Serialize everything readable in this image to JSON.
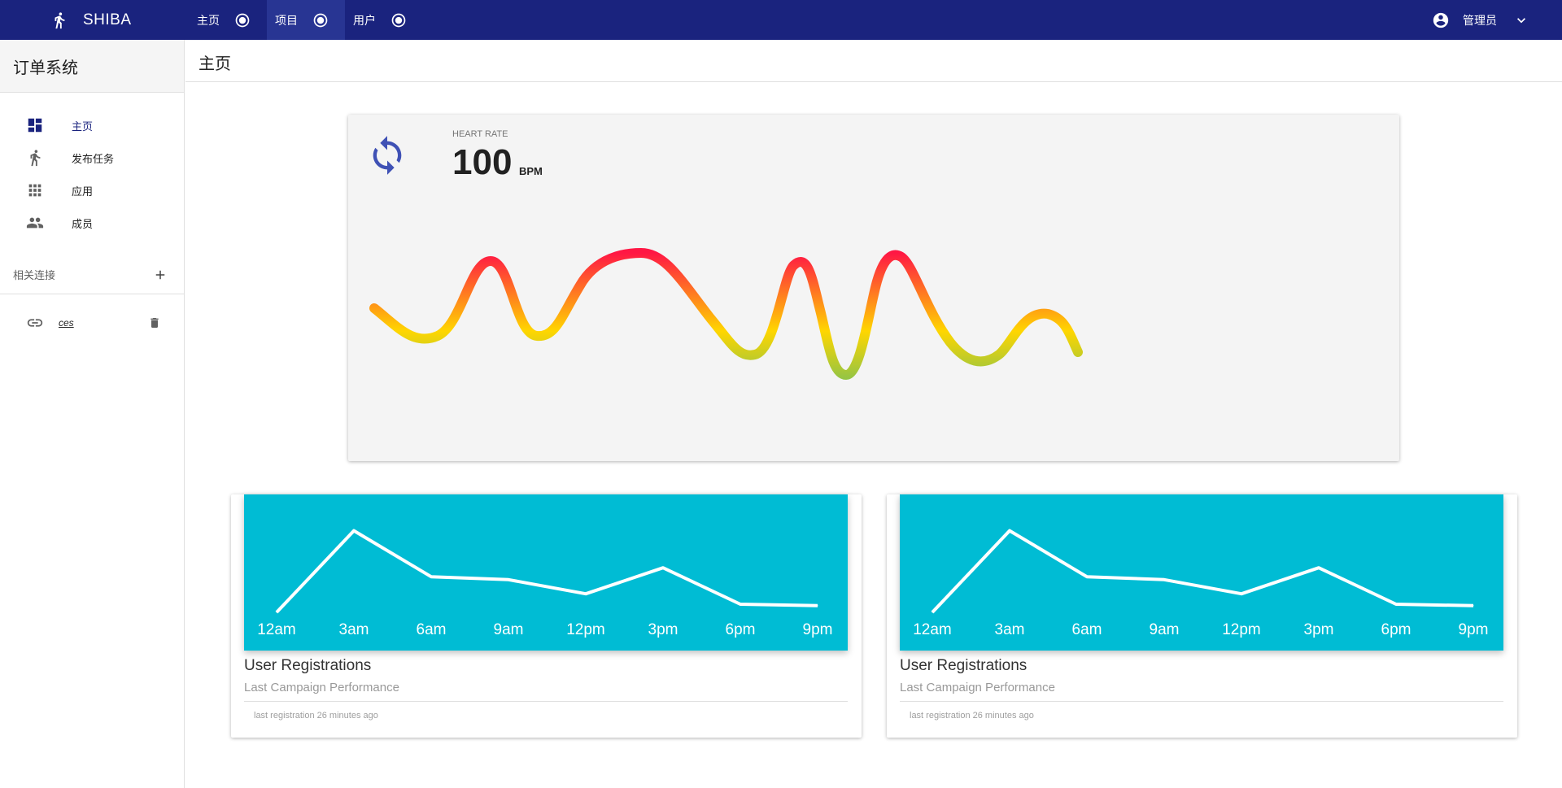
{
  "app": {
    "name": "SHIBA"
  },
  "topnav": [
    {
      "label": "主页",
      "active": false
    },
    {
      "label": "项目",
      "active": true
    },
    {
      "label": "用户",
      "active": false
    }
  ],
  "user": {
    "name": "管理员"
  },
  "sidebar": {
    "title": "订单系统",
    "items": [
      {
        "label": "主页",
        "icon": "dashboard-icon",
        "active": true
      },
      {
        "label": "发布任务",
        "icon": "runner-icon",
        "active": false
      },
      {
        "label": "应用",
        "icon": "apps-grid-icon",
        "active": false
      },
      {
        "label": "成员",
        "icon": "people-icon",
        "active": false
      }
    ],
    "links_header": "相关连接",
    "links": [
      {
        "label": "ces"
      }
    ]
  },
  "page": {
    "title": "主页"
  },
  "heart_rate": {
    "label": "HEART RATE",
    "value": "100",
    "unit": "BPM"
  },
  "registration_cards": [
    {
      "title": "User Registrations",
      "subtitle": "Last Campaign Performance",
      "footer": "last registration 26 minutes ago"
    },
    {
      "title": "User Registrations",
      "subtitle": "Last Campaign Performance",
      "footer": "last registration 26 minutes ago"
    }
  ],
  "chart_data": [
    {
      "type": "line",
      "categories": [
        "12am",
        "3am",
        "6am",
        "9am",
        "12pm",
        "3pm",
        "6pm",
        "9pm"
      ],
      "values": [
        0,
        110,
        48,
        44,
        25,
        60,
        11,
        9
      ],
      "ylim": [
        0,
        115
      ],
      "grid": false,
      "color": "#ffffff",
      "background": "#00bcd4"
    },
    {
      "type": "line",
      "categories": [
        "12am",
        "3am",
        "6am",
        "9am",
        "12pm",
        "3pm",
        "6pm",
        "9pm"
      ],
      "values": [
        0,
        110,
        48,
        44,
        25,
        60,
        11,
        9
      ],
      "ylim": [
        0,
        115
      ],
      "grid": false,
      "color": "#ffffff",
      "background": "#00bcd4"
    }
  ],
  "colors": {
    "topbar": "#1a237e",
    "accent": "#3f51b5",
    "chart_bg": "#00bcd4",
    "wave_red": "#ff1744",
    "wave_yellow": "#ffd600",
    "wave_green": "#8bc34a"
  }
}
